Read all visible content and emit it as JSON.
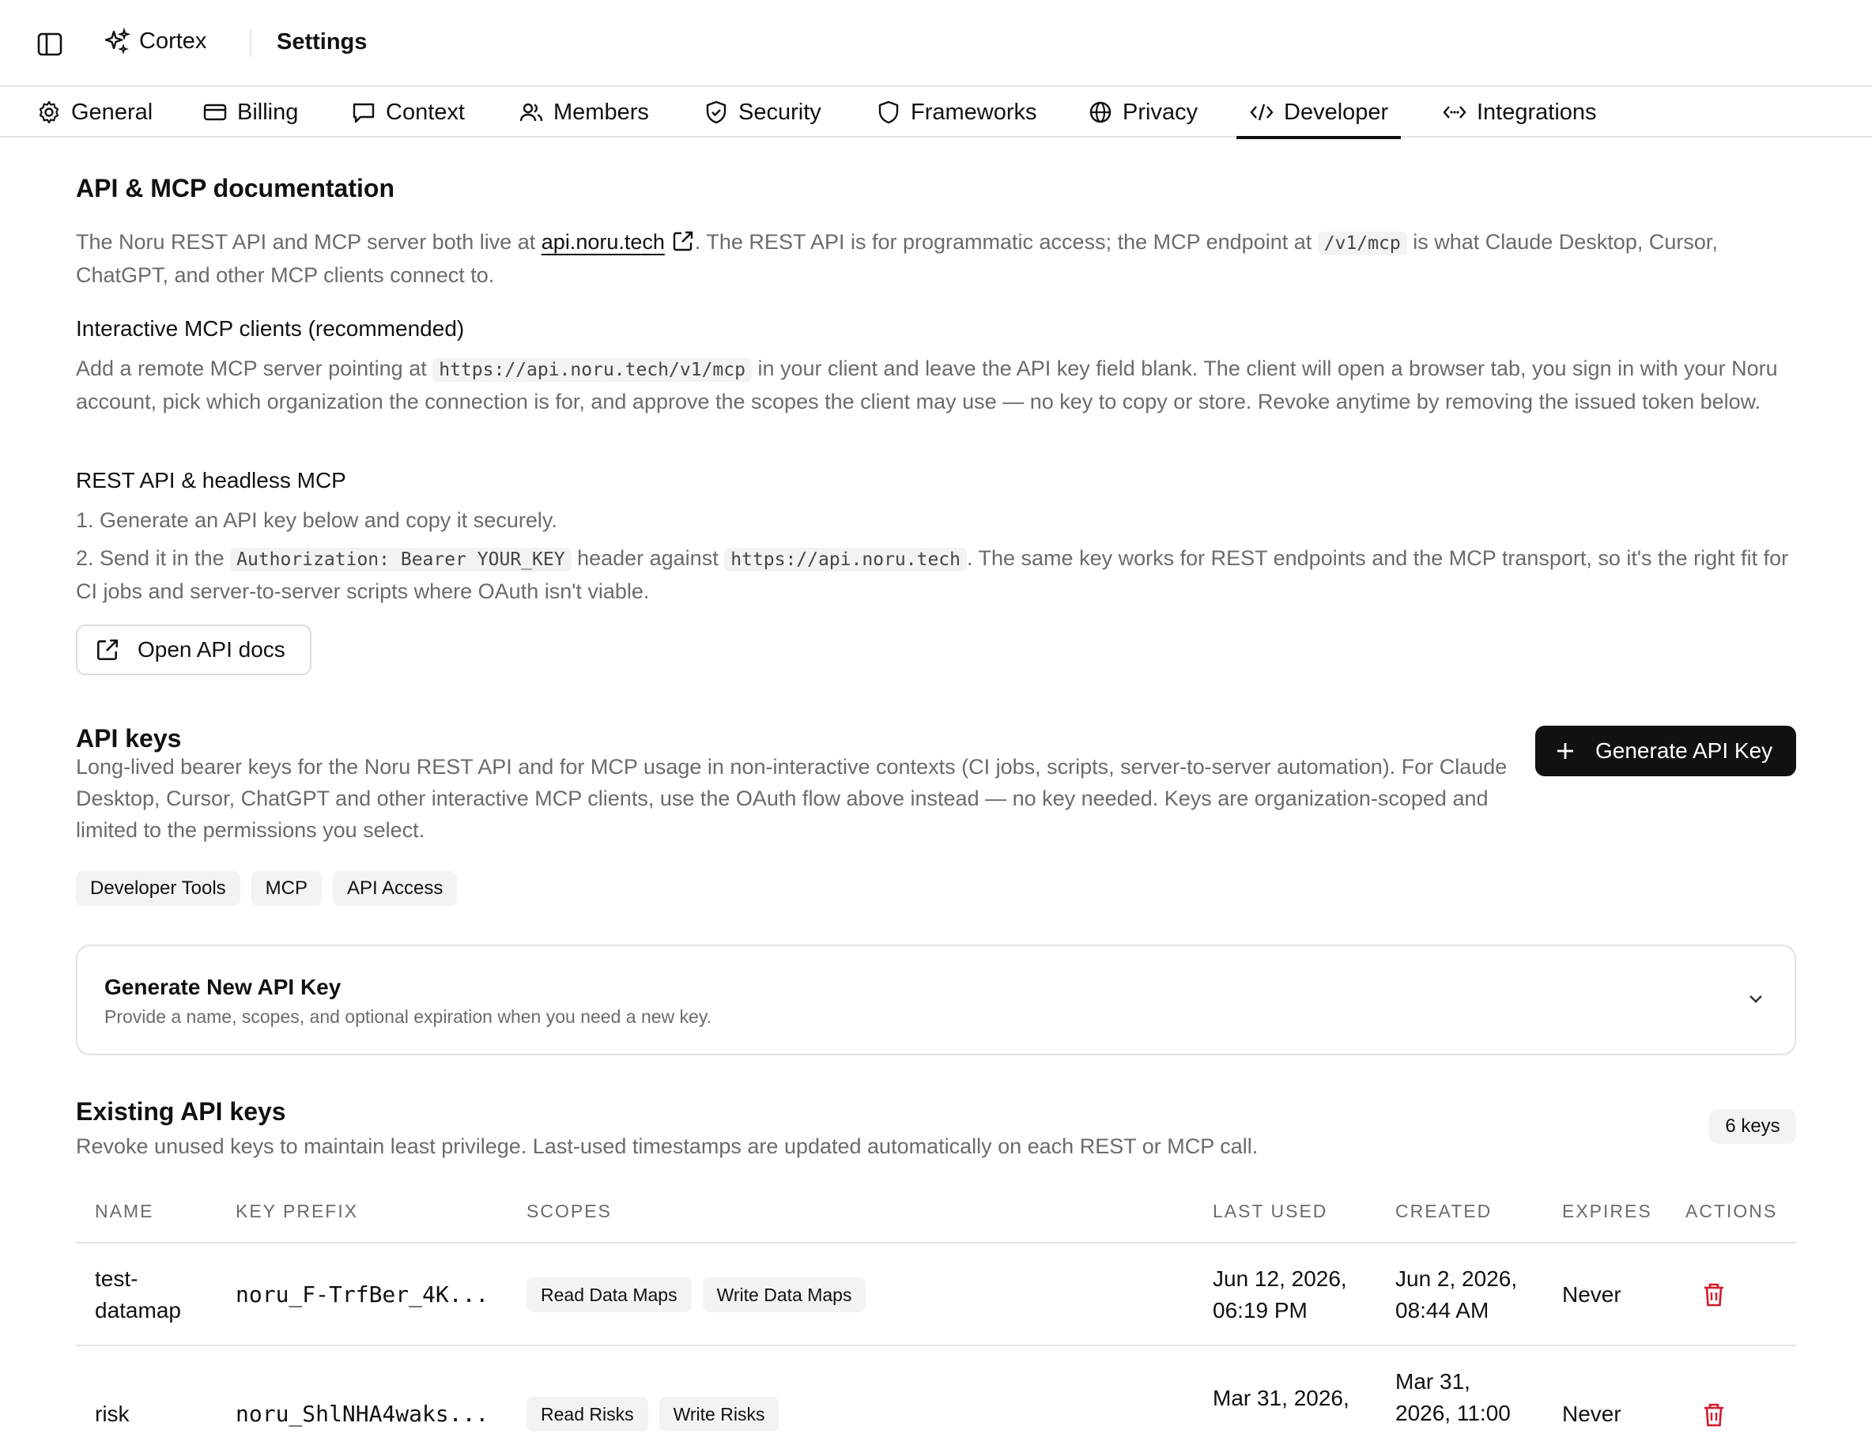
{
  "app": {
    "name": "Cortex",
    "page_title": "Settings"
  },
  "tabs": [
    {
      "label": "General",
      "icon": "gear-icon"
    },
    {
      "label": "Billing",
      "icon": "credit-card-icon"
    },
    {
      "label": "Context",
      "icon": "message-square-icon"
    },
    {
      "label": "Members",
      "icon": "users-icon"
    },
    {
      "label": "Security",
      "icon": "shield-check-icon"
    },
    {
      "label": "Frameworks",
      "icon": "shield-icon"
    },
    {
      "label": "Privacy",
      "icon": "globe-icon"
    },
    {
      "label": "Developer",
      "icon": "code-icon",
      "active": true
    },
    {
      "label": "Integrations",
      "icon": "code-xml-icon"
    }
  ],
  "docs": {
    "title": "API & MCP documentation",
    "intro_pre": "The Noru REST API and MCP server both live at ",
    "intro_link": "api.noru.tech",
    "intro_mid": ". The REST API is for programmatic access; the MCP endpoint at ",
    "intro_code": "/v1/mcp",
    "intro_post": " is what Claude Desktop, Cursor, ChatGPT, and other MCP clients connect to.",
    "interactive_title": "Interactive MCP clients (recommended)",
    "interactive_pre": "Add a remote MCP server pointing at ",
    "interactive_code": "https://api.noru.tech/v1/mcp",
    "interactive_post": " in your client and leave the API key field blank. The client will open a browser tab, you sign in with your Noru account, pick which organization the connection is for, and approve the scopes the client may use — no key to copy or store. Revoke anytime by removing the issued token below.",
    "rest_title": "REST API & headless MCP",
    "step1": "1. Generate an API key below and copy it securely.",
    "step2_pre": "2. Send it in the ",
    "step2_code1": "Authorization: Bearer YOUR_KEY",
    "step2_mid": " header against ",
    "step2_code2": "https://api.noru.tech",
    "step2_post": ". The same key works for REST endpoints and the MCP transport, so it's the right fit for CI jobs and server-to-server scripts where OAuth isn't viable.",
    "open_docs_label": "Open API docs"
  },
  "api_keys": {
    "title": "API keys",
    "description": "Long-lived bearer keys for the Noru REST API and for MCP usage in non-interactive contexts (CI jobs, scripts, server-to-server automation). For Claude Desktop, Cursor, ChatGPT and other interactive MCP clients, use the OAuth flow above instead — no key needed. Keys are organization-scoped and limited to the permissions you select.",
    "generate_label": "Generate API Key",
    "tags": [
      "Developer Tools",
      "MCP",
      "API Access"
    ]
  },
  "new_key_card": {
    "title": "Generate New API Key",
    "subtitle": "Provide a name, scopes, and optional expiration when you need a new key."
  },
  "existing": {
    "title": "Existing API keys",
    "subtitle": "Revoke unused keys to maintain least privilege. Last-used timestamps are updated automatically on each REST or MCP call.",
    "count": "6 keys",
    "columns": [
      "NAME",
      "KEY PREFIX",
      "SCOPES",
      "LAST USED",
      "CREATED",
      "EXPIRES",
      "ACTIONS"
    ],
    "rows": [
      {
        "name": "test-\ndatamap",
        "prefix": "noru_F-TrfBer_4K...",
        "scopes": [
          "Read Data Maps",
          "Write Data Maps"
        ],
        "last_used": "Jun 12, 2026,\n06:19 PM",
        "created": "Jun 2, 2026,\n08:44 AM",
        "expires": "Never"
      },
      {
        "name": "risk",
        "prefix": "noru_ShlNHA4waks...",
        "scopes": [
          "Read Risks",
          "Write Risks"
        ],
        "last_used": "Mar 31, 2026,",
        "created": "Mar 31,\n2026, 11:00",
        "expires": "Never"
      }
    ]
  }
}
